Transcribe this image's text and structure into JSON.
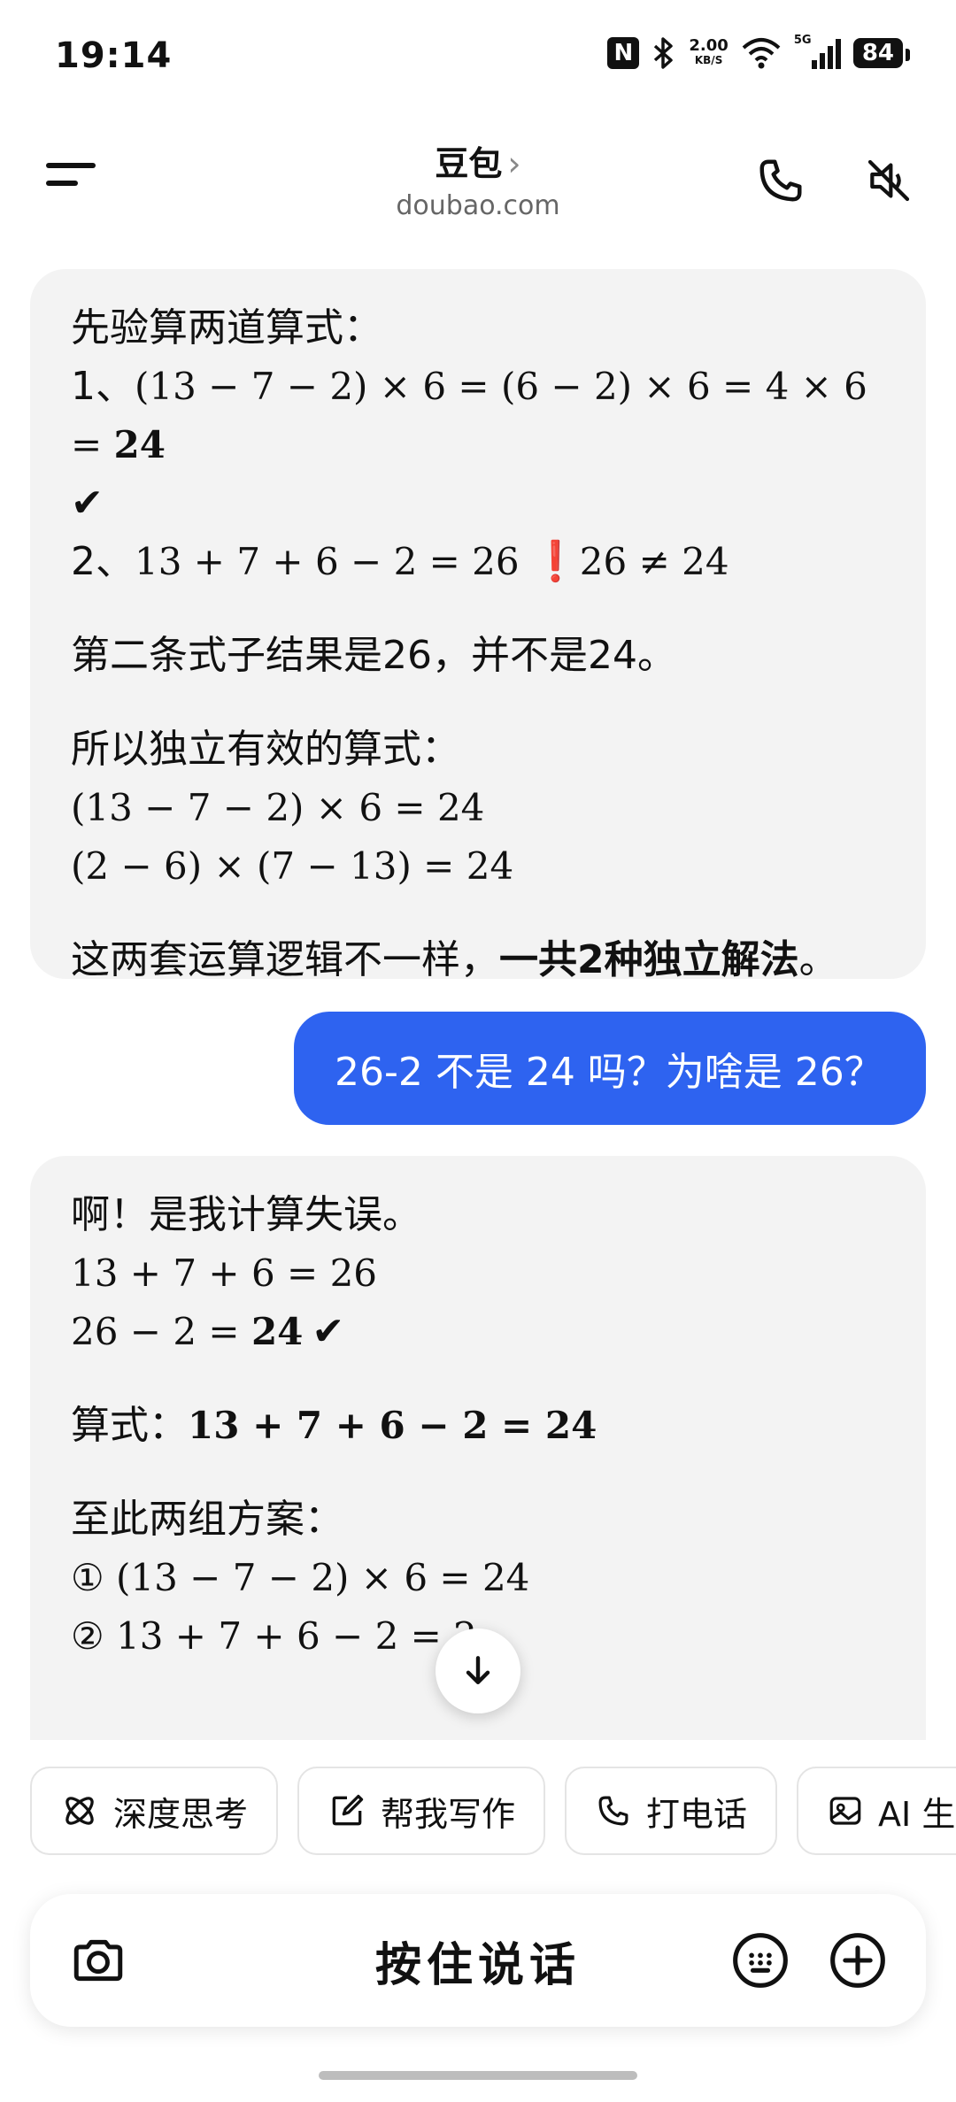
{
  "status_bar": {
    "time": "19:14",
    "nfc": "N",
    "speed_value": "2.00",
    "speed_unit": "KB/S",
    "network": "5G",
    "battery": "84"
  },
  "header": {
    "title": "豆包",
    "chevron": "›",
    "subtitle": "doubao.com"
  },
  "messages": {
    "ai1": {
      "l1": "先验算两道算式：",
      "l2_prefix": "1、",
      "l2_math": "(13 − 7 − 2) × 6 = (6 − 2) × 6 = 4 × 6 = ",
      "l2_result": "24",
      "l3_check": "✔",
      "l4_prefix": "2、",
      "l4_math": "13 + 7 + 6 − 2 = 26 ",
      "l4_warn": "❗",
      "l4_neq": "26 ≠ 24",
      "l5": "第二条式子结果是26，并不是24。",
      "l6": "所以独立有效的算式：",
      "l7": "(13 − 7 − 2) × 6 = 24",
      "l8": "(2 − 6) × (7 − 13) = 24",
      "l9_plain": "这两套运算逻辑不一样，",
      "l9_bold": "一共2种独立解法",
      "l9_end": "。"
    },
    "user1": "26-2 不是 24 吗？为啥是 26？",
    "ai2": {
      "l1": "啊！是我计算失误。",
      "l2": "13 + 7 + 6 = 26",
      "l3_math": "26 − 2 = ",
      "l3_bold": "24",
      "l3_check": "✔",
      "l4_label": "算式：",
      "l4_math": "13 + 7 + 6 − 2 = 24",
      "l5": "至此两组方案：",
      "l6": "① (13 − 7 − 2) × 6 = 24",
      "l7": "② 13 + 7 + 6 − 2 = 2"
    }
  },
  "chips": [
    {
      "label": "深度思考",
      "icon": "atom-icon"
    },
    {
      "label": "帮我写作",
      "icon": "edit-icon"
    },
    {
      "label": "打电话",
      "icon": "phone-icon"
    },
    {
      "label": "AI 生",
      "icon": "image-icon"
    }
  ],
  "input_bar": {
    "talk_label": "按住说话"
  },
  "colors": {
    "accent": "#2e63f0",
    "bubble_ai": "#f3f3f3",
    "warn": "#e03a2f"
  }
}
